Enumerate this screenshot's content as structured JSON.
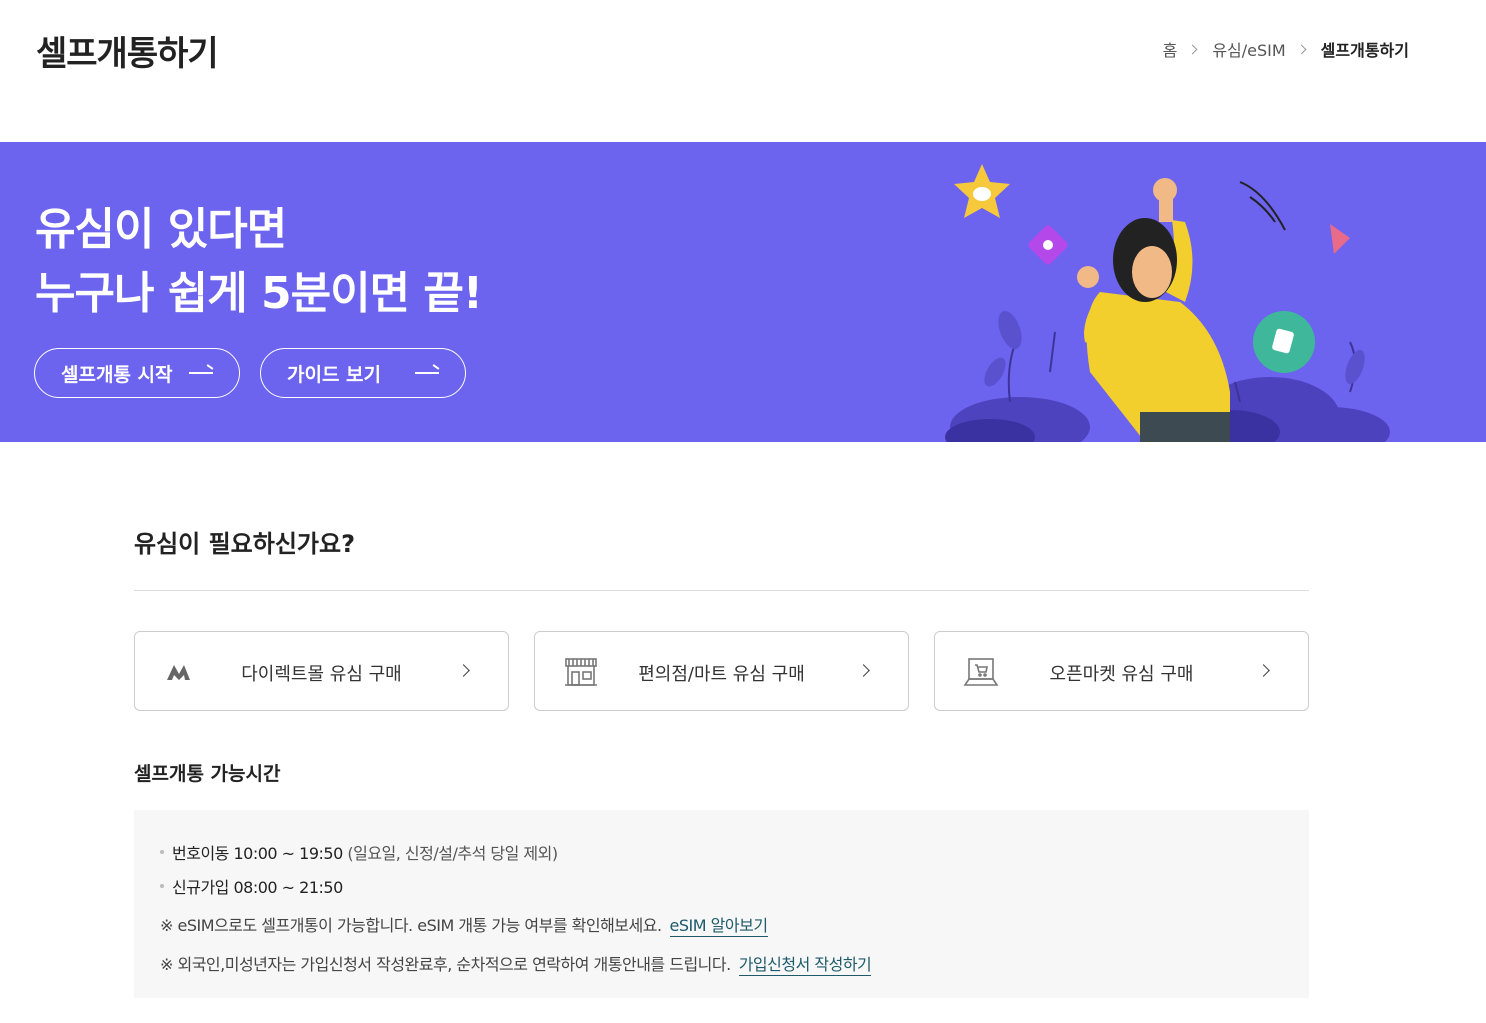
{
  "header": {
    "title": "셀프개통하기",
    "breadcrumb": [
      "홈",
      "유심/eSIM",
      "셀프개통하기"
    ]
  },
  "hero": {
    "line1": "유심이 있다면",
    "line2": "누구나 쉽게 5분이면 끝!",
    "start_button": "셀프개통 시작",
    "guide_button": "가이드 보기",
    "background_color": "#6c63ef"
  },
  "purchase": {
    "title": "유심이 필요하신가요?",
    "cards": [
      {
        "label": "다이렉트몰 유심 구매",
        "icon": "direct-mall-logo-icon"
      },
      {
        "label": "편의점/마트 유심 구매",
        "icon": "store-icon"
      },
      {
        "label": "오픈마켓 유심 구매",
        "icon": "laptop-cart-icon"
      }
    ]
  },
  "hours": {
    "title": "셀프개통 가능시간",
    "port_label": "번호이동 10:00 ~ 19:50",
    "port_note": "(일요일, 신정/설/추석 당일 제외)",
    "new_label": "신규가입 08:00 ~ 21:50",
    "esim_note": "※ eSIM으로도 셀프개통이 가능합니다. eSIM 개통 가능 여부를 확인해보세요.",
    "esim_link": "eSIM 알아보기",
    "foreign_note": "※ 외국인,미성년자는 가입신청서 작성완료후, 순차적으로 연락하여 개통안내를 드립니다.",
    "foreign_link": "가입신청서 작성하기",
    "link_color": "#1e5a6a"
  }
}
